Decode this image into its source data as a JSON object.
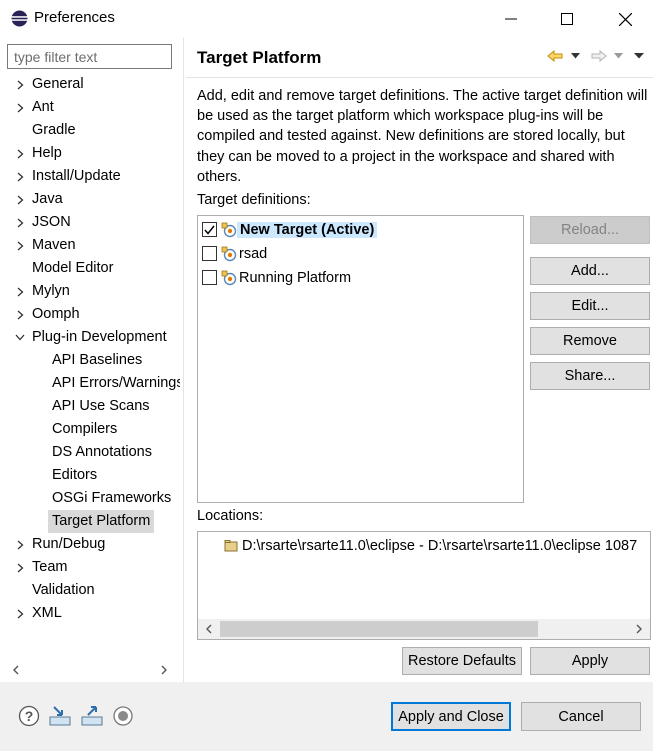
{
  "window": {
    "title": "Preferences"
  },
  "filter": {
    "placeholder": "type filter text"
  },
  "tree": [
    {
      "label": "General",
      "expandable": true,
      "expanded": false,
      "level": 0
    },
    {
      "label": "Ant",
      "expandable": true,
      "expanded": false,
      "level": 0
    },
    {
      "label": "Gradle",
      "expandable": false,
      "level": 0
    },
    {
      "label": "Help",
      "expandable": true,
      "expanded": false,
      "level": 0
    },
    {
      "label": "Install/Update",
      "expandable": true,
      "expanded": false,
      "level": 0
    },
    {
      "label": "Java",
      "expandable": true,
      "expanded": false,
      "level": 0
    },
    {
      "label": "JSON",
      "expandable": true,
      "expanded": false,
      "level": 0
    },
    {
      "label": "Maven",
      "expandable": true,
      "expanded": false,
      "level": 0
    },
    {
      "label": "Model Editor",
      "expandable": false,
      "level": 0
    },
    {
      "label": "Mylyn",
      "expandable": true,
      "expanded": false,
      "level": 0
    },
    {
      "label": "Oomph",
      "expandable": true,
      "expanded": false,
      "level": 0
    },
    {
      "label": "Plug-in Development",
      "expandable": true,
      "expanded": true,
      "level": 0
    },
    {
      "label": "API Baselines",
      "expandable": false,
      "level": 1
    },
    {
      "label": "API Errors/Warnings",
      "expandable": false,
      "level": 1
    },
    {
      "label": "API Use Scans",
      "expandable": false,
      "level": 1
    },
    {
      "label": "Compilers",
      "expandable": false,
      "level": 1
    },
    {
      "label": "DS Annotations",
      "expandable": false,
      "level": 1
    },
    {
      "label": "Editors",
      "expandable": false,
      "level": 1
    },
    {
      "label": "OSGi Frameworks",
      "expandable": false,
      "level": 1
    },
    {
      "label": "Target Platform",
      "expandable": false,
      "level": 1,
      "selected": true
    },
    {
      "label": "Run/Debug",
      "expandable": true,
      "expanded": false,
      "level": 0
    },
    {
      "label": "Team",
      "expandable": true,
      "expanded": false,
      "level": 0
    },
    {
      "label": "Validation",
      "expandable": false,
      "level": 0
    },
    {
      "label": "XML",
      "expandable": true,
      "expanded": false,
      "level": 0
    }
  ],
  "page": {
    "title": "Target Platform",
    "description": "Add, edit and remove target definitions.  The active target definition will be used as the target platform which workspace plug-ins will be compiled and tested against.  New definitions are stored locally, but they can be moved to a project in the workspace and shared with others.",
    "target_definitions_label": "Target definitions:",
    "targets": [
      {
        "label": "New Target (Active)",
        "checked": true,
        "active": true
      },
      {
        "label": "rsad",
        "checked": false,
        "active": false
      },
      {
        "label": "Running Platform",
        "checked": false,
        "active": false
      }
    ],
    "side_buttons": {
      "reload": "Reload...",
      "add": "Add...",
      "edit": "Edit...",
      "remove": "Remove",
      "share": "Share..."
    },
    "locations_label": "Locations:",
    "locations": [
      "D:\\rsarte\\rsarte11.0\\eclipse - D:\\rsarte\\rsarte11.0\\eclipse 1087"
    ],
    "restore_defaults": "Restore Defaults",
    "apply": "Apply"
  },
  "footer": {
    "apply_and_close": "Apply and Close",
    "cancel": "Cancel"
  },
  "colors": {
    "selection_highlight": "#cce8ff",
    "tree_selection": "#d9d9d9",
    "default_button_border": "#0078d7",
    "back_arrow": "#e8a400"
  }
}
